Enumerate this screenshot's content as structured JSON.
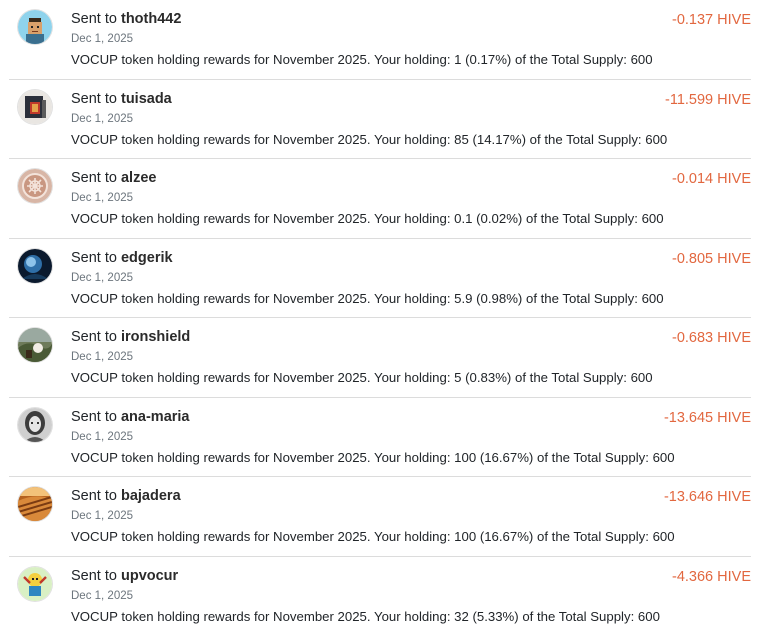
{
  "wallet_history": {
    "sent_to_label": "Sent to",
    "transactions": [
      {
        "user": "thoth442",
        "date": "Dec 1, 2025",
        "memo": "VOCUP token holding rewards for November 2025. Your holding: 1 (0.17%) of the Total Supply: 600",
        "amount": "-0.137 HIVE",
        "avatar_icon": "pixel-character-avatar-icon"
      },
      {
        "user": "tuisada",
        "date": "Dec 1, 2025",
        "memo": "VOCUP token holding rewards for November 2025. Your holding: 85 (14.17%) of the Total Supply: 600",
        "amount": "-11.599 HIVE",
        "avatar_icon": "photo-avatar-icon"
      },
      {
        "user": "alzee",
        "date": "Dec 1, 2025",
        "memo": "VOCUP token holding rewards for November 2025. Your holding: 0.1 (0.02%) of the Total Supply: 600",
        "amount": "-0.014 HIVE",
        "avatar_icon": "celtic-knot-avatar-icon"
      },
      {
        "user": "edgerik",
        "date": "Dec 1, 2025",
        "memo": "VOCUP token holding rewards for November 2025. Your holding: 5.9 (0.98%) of the Total Supply: 600",
        "amount": "-0.805 HIVE",
        "avatar_icon": "dark-blue-avatar-icon"
      },
      {
        "user": "ironshield",
        "date": "Dec 1, 2025",
        "memo": "VOCUP token holding rewards for November 2025. Your holding: 5 (0.83%) of the Total Supply: 600",
        "amount": "-0.683 HIVE",
        "avatar_icon": "landscape-avatar-icon"
      },
      {
        "user": "ana-maria",
        "date": "Dec 1, 2025",
        "memo": "VOCUP token holding rewards for November 2025. Your holding: 100 (16.67%) of the Total Supply: 600",
        "amount": "-13.645 HIVE",
        "avatar_icon": "portrait-avatar-icon"
      },
      {
        "user": "bajadera",
        "date": "Dec 1, 2025",
        "memo": "VOCUP token holding rewards for November 2025. Your holding: 100 (16.67%) of the Total Supply: 600",
        "amount": "-13.646 HIVE",
        "avatar_icon": "sunset-fields-avatar-icon"
      },
      {
        "user": "upvocur",
        "date": "Dec 1, 2025",
        "memo": "VOCUP token holding rewards for November 2025. Your holding: 32 (5.33%) of the Total Supply: 600",
        "amount": "-4.366 HIVE",
        "avatar_icon": "cartoon-mascot-avatar-icon"
      }
    ]
  },
  "colors": {
    "amount": "#e2673f",
    "divider": "#dcdcdc",
    "date": "#6c757d"
  }
}
